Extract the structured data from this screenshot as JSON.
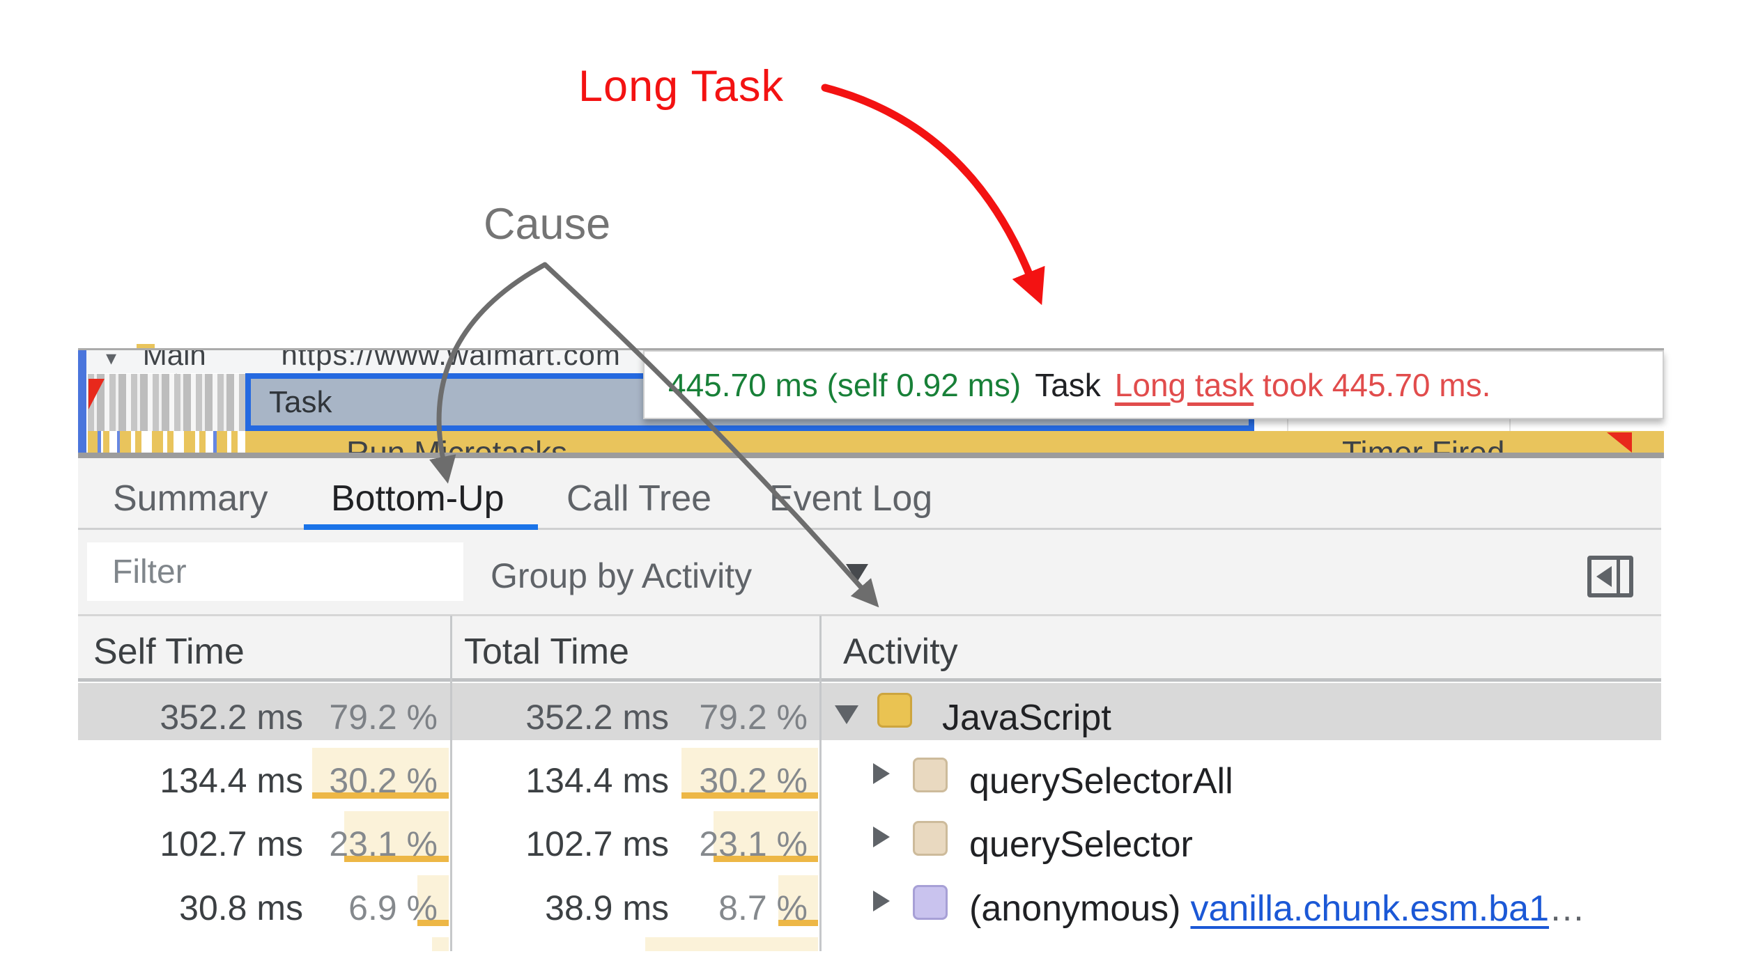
{
  "annotations": {
    "long_task_label": "Long Task",
    "cause_label": "Cause"
  },
  "flame": {
    "track_caret": "▾",
    "track_name": "Main",
    "track_url": "https://www.walmart.com",
    "task_label": "Task",
    "microtasks_label": "Run Microtasks",
    "timer_label": "Timer Fired",
    "tooltip": {
      "timing": "445.70 ms (self 0.92 ms)",
      "category": "Task",
      "link_text": "Long task",
      "suffix": " took 445.70 ms."
    }
  },
  "panel": {
    "tabs": [
      {
        "label": "Summary"
      },
      {
        "label": "Bottom-Up"
      },
      {
        "label": "Call Tree"
      },
      {
        "label": "Event Log"
      }
    ],
    "active_tab": "Bottom-Up",
    "filter": {
      "placeholder": "Filter"
    },
    "group_by": {
      "label": "Group by Activity"
    },
    "table": {
      "headers": {
        "self": "Self Time",
        "total": "Total Time",
        "activity": "Activity"
      },
      "rows": [
        {
          "self_ms": "352.2 ms",
          "self_pct": "79.2 %",
          "self_pct_num": 79.2,
          "total_ms": "352.2 ms",
          "total_pct": "79.2 %",
          "total_pct_num": 79.2,
          "label": "JavaScript",
          "selected": true,
          "expanded": true,
          "swatch_style": "background:#eac352;border:3px solid #cda53e"
        },
        {
          "self_ms": "134.4 ms",
          "self_pct": "30.2 %",
          "self_pct_num": 30.2,
          "total_ms": "134.4 ms",
          "total_pct": "30.2 %",
          "total_pct_num": 30.2,
          "label": "querySelectorAll",
          "swatch_style": "background:#e9d9c0;border:3px solid #cdbb9b"
        },
        {
          "self_ms": "102.7 ms",
          "self_pct": "23.1 %",
          "self_pct_num": 23.1,
          "total_ms": "102.7 ms",
          "total_pct": "23.1 %",
          "total_pct_num": 23.1,
          "label": "querySelector",
          "swatch_style": "background:#e9d9c0;border:3px solid #cdbb9b"
        },
        {
          "self_ms": "30.8 ms",
          "self_pct": "6.9 %",
          "self_pct_num": 6.9,
          "total_ms": "38.9 ms",
          "total_pct": "8.7 %",
          "total_pct_num": 8.7,
          "label": "(anonymous)",
          "link_text": "vanilla.chunk.esm.ba1",
          "ellipsis": "…",
          "swatch_style": "background:#c9c3ee;border:3px solid #a7a0d6"
        }
      ],
      "partial_row": {
        "self_pct_num": 3.7,
        "total_pct_num": 38.2
      }
    }
  },
  "colors": {
    "accent_blue": "#1a73e8",
    "link_blue": "#1b58d6",
    "long_task_red": "#f31212",
    "tooltip_red": "#e14c4c",
    "tooltip_green": "#188038",
    "flame_marker_red": "#e8291c",
    "selected_row_gray": "#d9d9d9",
    "pct_fill": "#fbf2d9",
    "pct_border": "#edb746",
    "js_yellow": "#eac352",
    "dom_beige": "#e9d9c0",
    "anon_purple": "#c9c3ee",
    "flame_yellow": "#e9c45c",
    "task_fill": "#a8b5c6",
    "task_border": "#2569e0",
    "annotation_gray": "#6d6d6d"
  }
}
